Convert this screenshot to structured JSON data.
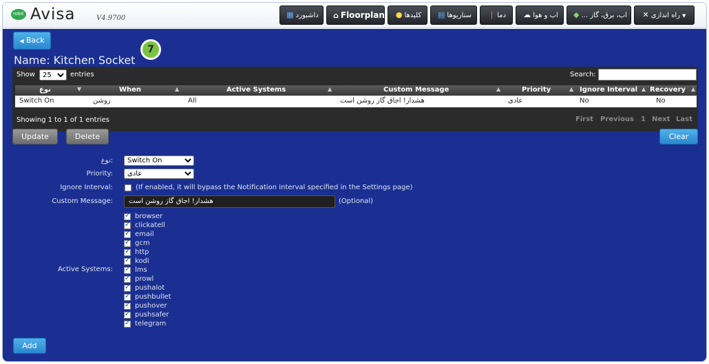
{
  "app": {
    "logo_badge": "HIBIE",
    "name": "Avisa",
    "version": "V4.9700"
  },
  "nav": [
    {
      "label": "داشبورد",
      "icon": "dashboard-icon"
    },
    {
      "label": "Floorplan",
      "icon": "home-icon"
    },
    {
      "label": "کلیدها",
      "icon": "bulb-icon"
    },
    {
      "label": "سناریوها",
      "icon": "clapper-icon"
    },
    {
      "label": "دما",
      "icon": "thermometer-icon"
    },
    {
      "label": "اب و هوا",
      "icon": "cloud-icon"
    },
    {
      "label": "... اب، برق، گاز",
      "icon": "gas-icon"
    },
    {
      "label": "راه اندازی",
      "icon": "tools-icon"
    }
  ],
  "page": {
    "back_label": "Back",
    "title": "Name: Kitchen Socket",
    "step": "7"
  },
  "table": {
    "show_label": "Show",
    "page_size": "25",
    "entries_label": "entries",
    "search_label": "Search:",
    "columns": [
      "نوع",
      "When",
      "Active Systems",
      "Custom Message",
      "Priority",
      "Ignore Interval",
      "Recovery"
    ],
    "rows": [
      [
        "Switch On",
        "روشن",
        "All",
        "هشدار! اجاق گاز روشن است",
        "عادی",
        "No",
        "No"
      ]
    ],
    "info": "Showing 1 to 1 of 1 entries",
    "pager": [
      "First",
      "Previous",
      "1",
      "Next",
      "Last"
    ]
  },
  "actions": {
    "update": "Update",
    "delete": "Delete",
    "clear": "Clear",
    "add": "Add"
  },
  "form": {
    "type_label": "نوع:",
    "type_value": "Switch On",
    "priority_label": "Priority:",
    "priority_value": "عادی",
    "ignore_label": "Ignore Interval:",
    "ignore_note": "(If enabled, it will bypass the Notification interval specified in the Settings page)",
    "message_label": "Custom Message:",
    "message_value": "هشدار! اجاق گاز روشن است",
    "optional": "(Optional)",
    "systems_label": "Active Systems:",
    "systems": [
      "browser",
      "clickatell",
      "email",
      "gcm",
      "http",
      "kodi",
      "lms",
      "prowl",
      "pushalot",
      "pushbullet",
      "pushover",
      "pushsafer",
      "telegram"
    ]
  }
}
